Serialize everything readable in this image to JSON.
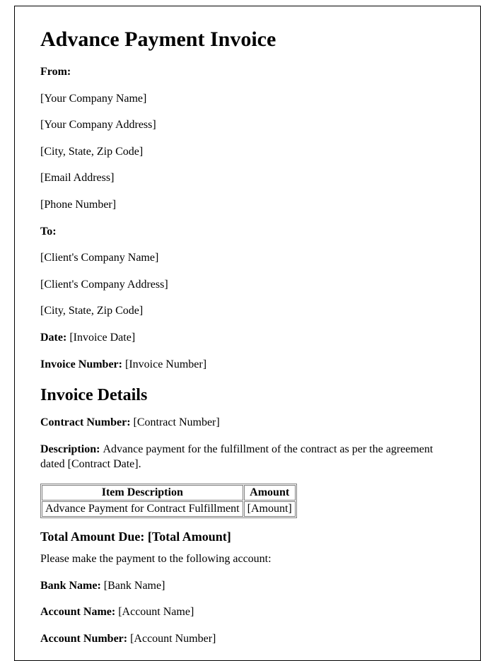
{
  "title": "Advance Payment Invoice",
  "from": {
    "label": "From:",
    "companyName": "[Your Company Name]",
    "companyAddress": "[Your Company Address]",
    "cityStateZip": "[City, State, Zip Code]",
    "email": "[Email Address]",
    "phone": "[Phone Number]"
  },
  "to": {
    "label": "To:",
    "companyName": "[Client's Company Name]",
    "companyAddress": "[Client's Company Address]",
    "cityStateZip": "[City, State, Zip Code]"
  },
  "date": {
    "label": "Date: ",
    "value": "[Invoice Date]"
  },
  "invoiceNumber": {
    "label": "Invoice Number: ",
    "value": "[Invoice Number]"
  },
  "detailsHeading": "Invoice Details",
  "contractNumber": {
    "label": "Contract Number: ",
    "value": "[Contract Number]"
  },
  "description": {
    "label": "Description: ",
    "value": "Advance payment for the fulfillment of the contract as per the agreement dated [Contract Date]."
  },
  "table": {
    "headers": [
      "Item Description",
      "Amount"
    ],
    "row": {
      "description": "Advance Payment for Contract Fulfillment",
      "amount": "[Amount]"
    }
  },
  "totalDue": {
    "label": "Total Amount Due: ",
    "value": "[Total Amount]"
  },
  "paymentInstruction": "Please make the payment to the following account:",
  "bank": {
    "nameLabel": "Bank Name: ",
    "nameValue": "[Bank Name]",
    "accountNameLabel": "Account Name: ",
    "accountNameValue": "[Account Name]",
    "accountNumberLabel": "Account Number: ",
    "accountNumberValue": "[Account Number]"
  }
}
